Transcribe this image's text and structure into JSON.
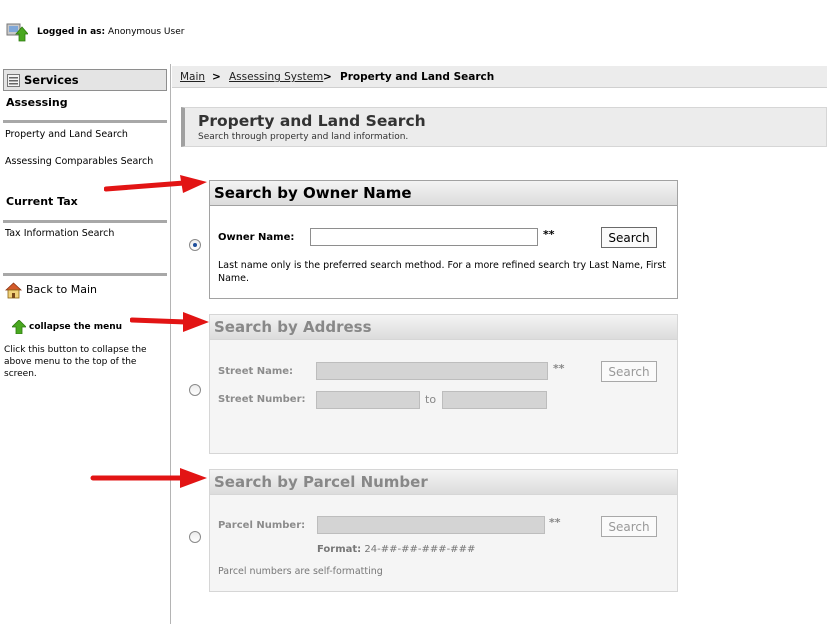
{
  "header": {
    "logged_in_label": "Logged in as:",
    "user_name": "Anonymous User"
  },
  "sidebar": {
    "services_label": "Services",
    "assessing_title": "Assessing",
    "assessing_links": [
      "Property and Land Search",
      "Assessing Comparables Search"
    ],
    "current_tax_title": "Current Tax",
    "tax_links": [
      "Tax Information Search"
    ],
    "back_label": "Back to Main",
    "collapse_label": "collapse the menu",
    "collapse_help": "Click this button to collapse the above menu to the top of the screen."
  },
  "breadcrumb": {
    "items": [
      "Main",
      "Assessing System"
    ],
    "separator": ">",
    "current": "Property and Land Search"
  },
  "page": {
    "title": "Property and Land Search",
    "subtitle": "Search through property and land information."
  },
  "owner_search": {
    "title": "Search by Owner Name",
    "field_label": "Owner Name:",
    "value": "",
    "required_mark": "**",
    "button_label": "Search",
    "note": "Last name only is the preferred search method. For a more refined search try Last Name, First Name."
  },
  "address_search": {
    "title": "Search by Address",
    "street_name_label": "Street Name:",
    "street_number_label": "Street Number:",
    "required_mark": "**",
    "to_label": "to",
    "button_label": "Search"
  },
  "parcel_search": {
    "title": "Search by Parcel Number",
    "field_label": "Parcel Number:",
    "required_mark": "**",
    "format_label": "Format:",
    "format_value": "24-##-##-###-###",
    "button_label": "Search",
    "note": "Parcel numbers are self-formatting"
  },
  "colors": {
    "arrow": "#e21414",
    "radio_selected": "#1e4f9c",
    "home_icon": "#d35a2a",
    "up_arrow_icon": "#49a820"
  }
}
